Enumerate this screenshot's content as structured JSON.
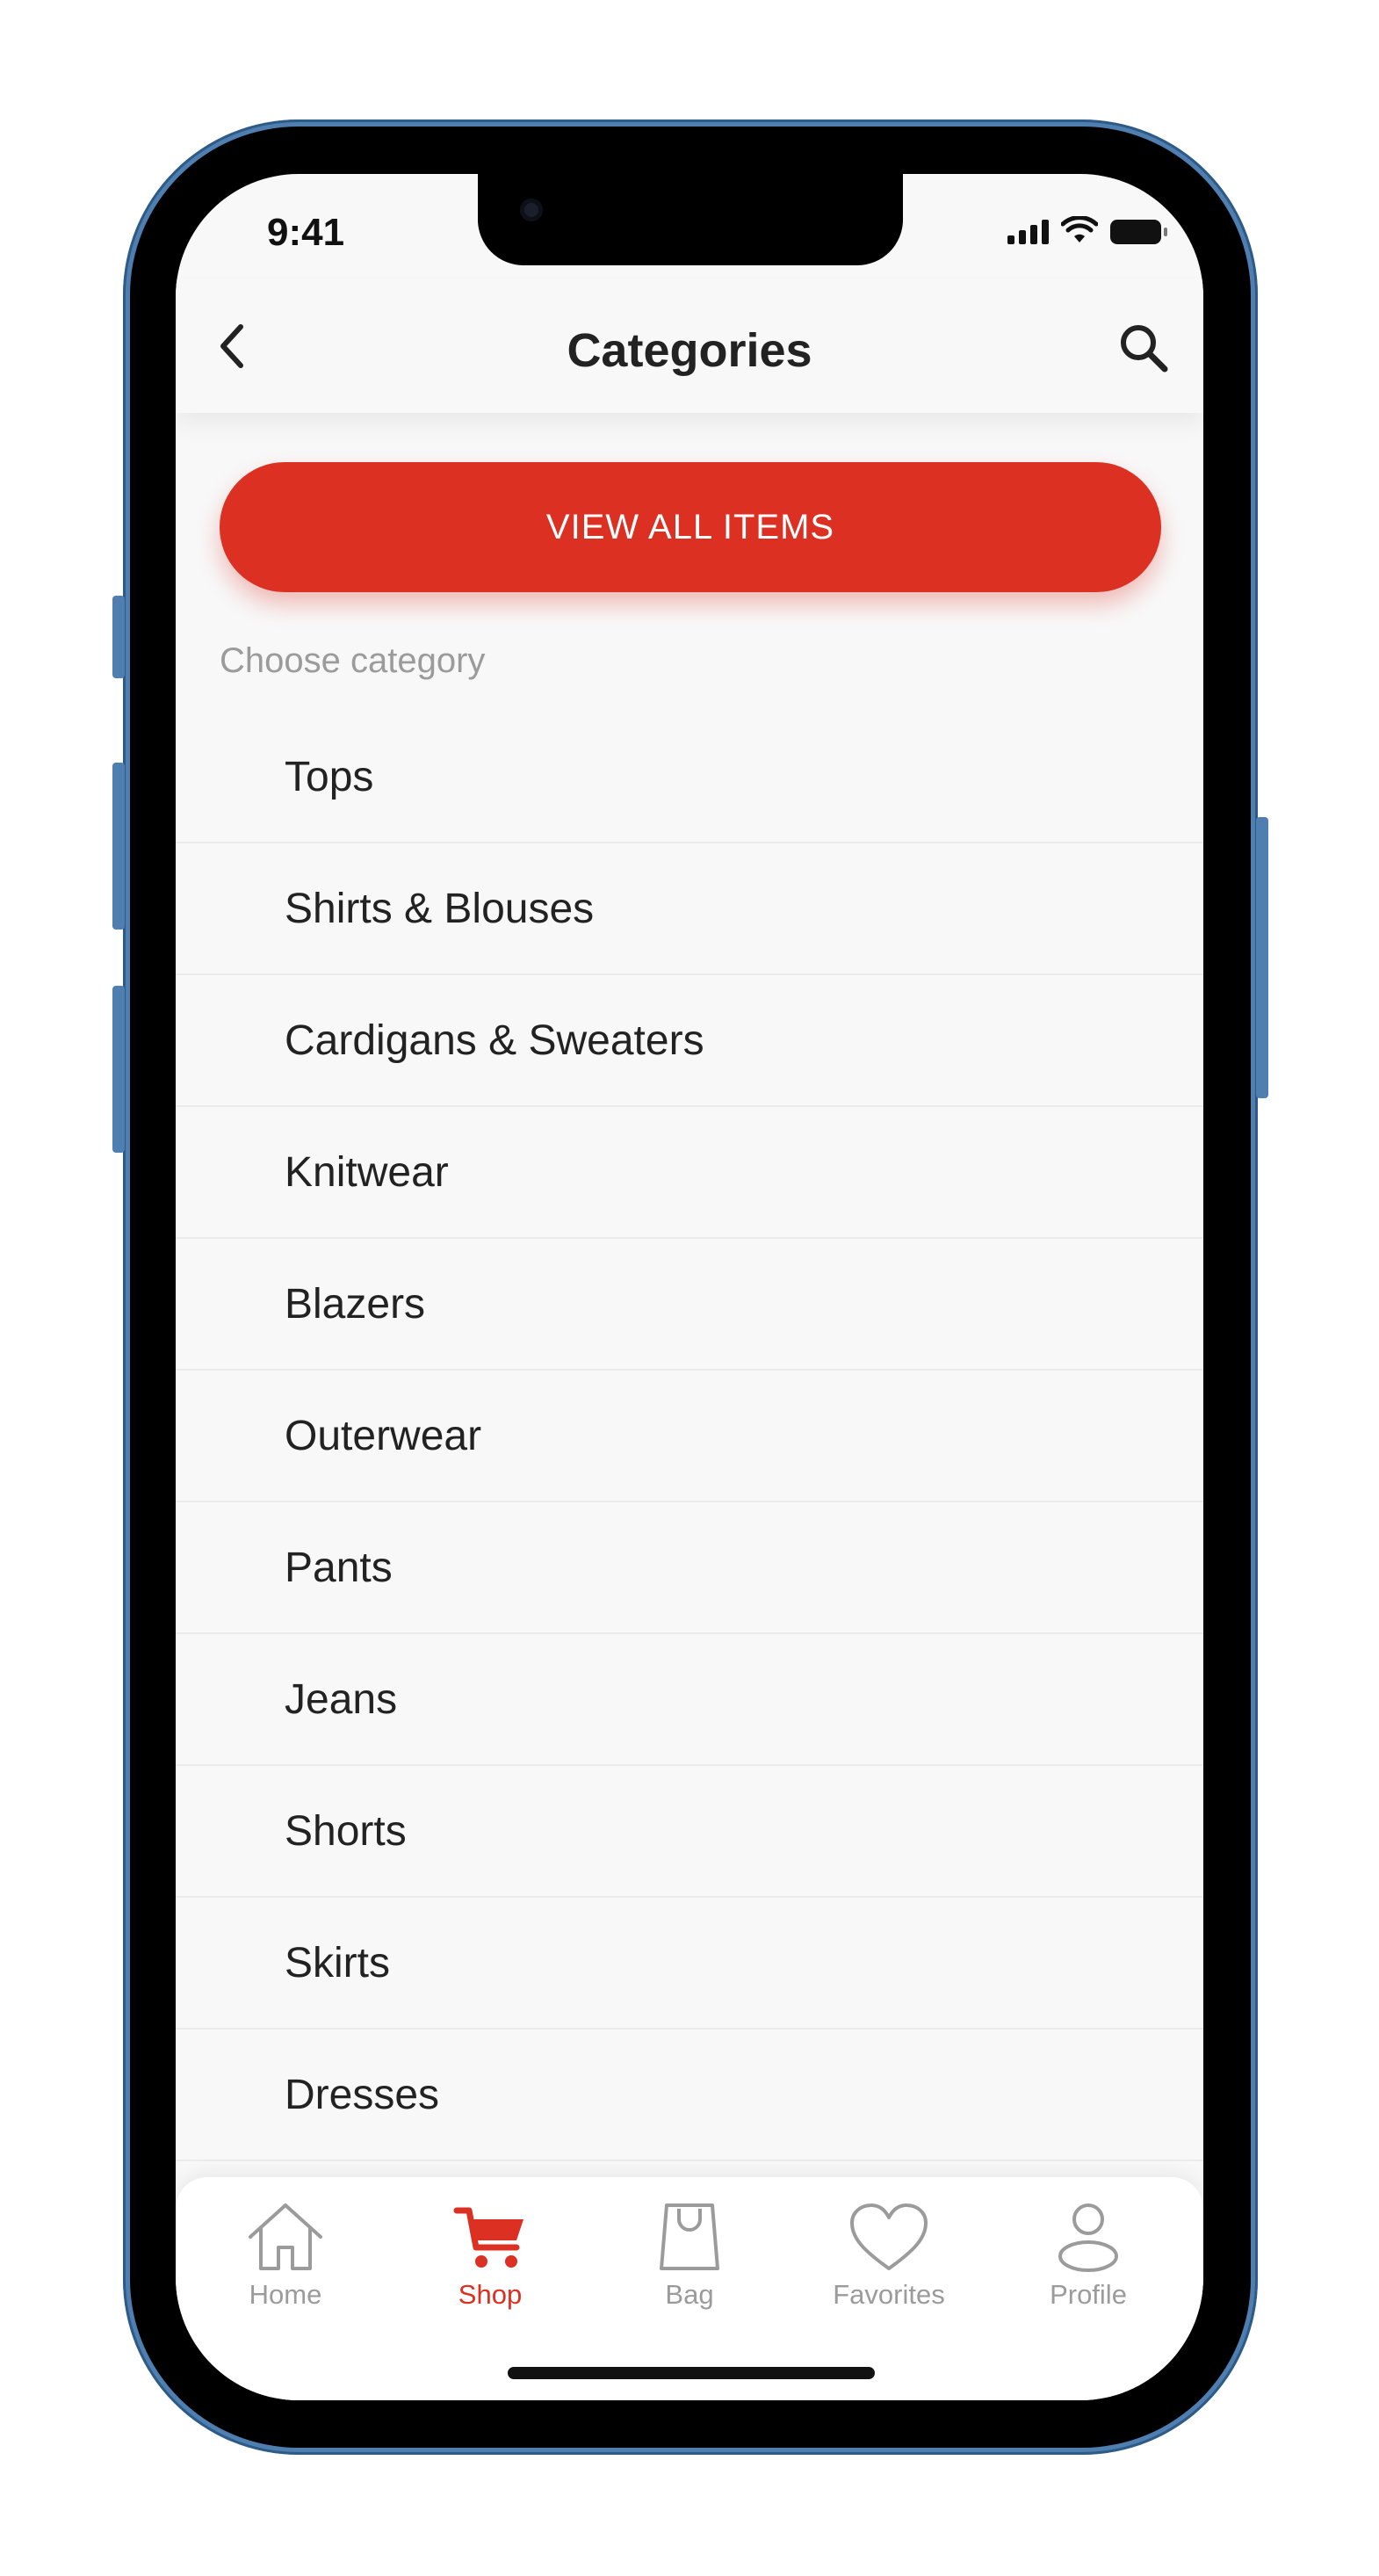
{
  "status_bar": {
    "time": "9:41"
  },
  "header": {
    "title": "Categories",
    "back_icon": "chevron-left-icon",
    "search_icon": "search-icon"
  },
  "view_all_button": {
    "label": "VIEW ALL ITEMS"
  },
  "section_label": "Choose category",
  "categories": [
    "Tops",
    "Shirts & Blouses",
    "Cardigans & Sweaters",
    "Knitwear",
    "Blazers",
    "Outerwear",
    "Pants",
    "Jeans",
    "Shorts",
    "Skirts",
    "Dresses"
  ],
  "tab_bar": {
    "active": "Shop",
    "tabs": [
      {
        "label": "Home",
        "icon": "home-icon"
      },
      {
        "label": "Shop",
        "icon": "cart-icon"
      },
      {
        "label": "Bag",
        "icon": "bag-icon"
      },
      {
        "label": "Favorites",
        "icon": "heart-icon"
      },
      {
        "label": "Profile",
        "icon": "profile-icon"
      }
    ]
  },
  "colors": {
    "accent": "#db3022",
    "background": "#f8f8f8",
    "frame": "#4f7fb0"
  }
}
